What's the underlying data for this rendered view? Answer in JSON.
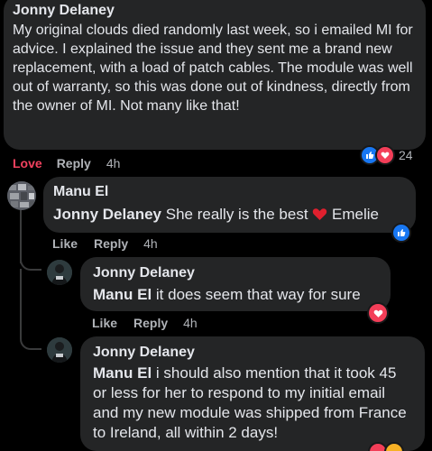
{
  "comments": [
    {
      "author": "Jonny Delaney",
      "text": "My original clouds died randomly last week, so i emailed MI for advice. I explained the issue and they sent me a brand new replacement, with a load of patch cables. The module was well out of warranty, so this was done out of kindness, directly from the owner of MI. Not many like that!",
      "reaction_label": "Love",
      "reply_label": "Reply",
      "time": "4h",
      "reaction_count": "24"
    },
    {
      "author": "Manu El",
      "mention": "Jonny Delaney",
      "text_before_emoji": "She really is the best",
      "text_after_emoji": "Emelie",
      "like_label": "Like",
      "reply_label": "Reply",
      "time": "4h"
    },
    {
      "author": "Jonny Delaney",
      "mention": "Manu El",
      "text": "it does seem that way for sure",
      "like_label": "Like",
      "reply_label": "Reply",
      "time": "4h"
    },
    {
      "author": "Jonny Delaney",
      "mention": "Manu El",
      "text": "i should also mention that it took 45 or less for her to respond to my initial email and my new module was shipped from France to Ireland, all within 2 days!"
    }
  ],
  "colors": {
    "background": "#000000",
    "bubble": "#242526",
    "text": "#e4e6eb",
    "muted": "#b0b3b8",
    "love": "#f3425f",
    "like": "#1877f2"
  },
  "icons": [
    "like-reaction-icon",
    "love-reaction-icon",
    "haha-reaction-icon",
    "heart-emoji-icon"
  ]
}
